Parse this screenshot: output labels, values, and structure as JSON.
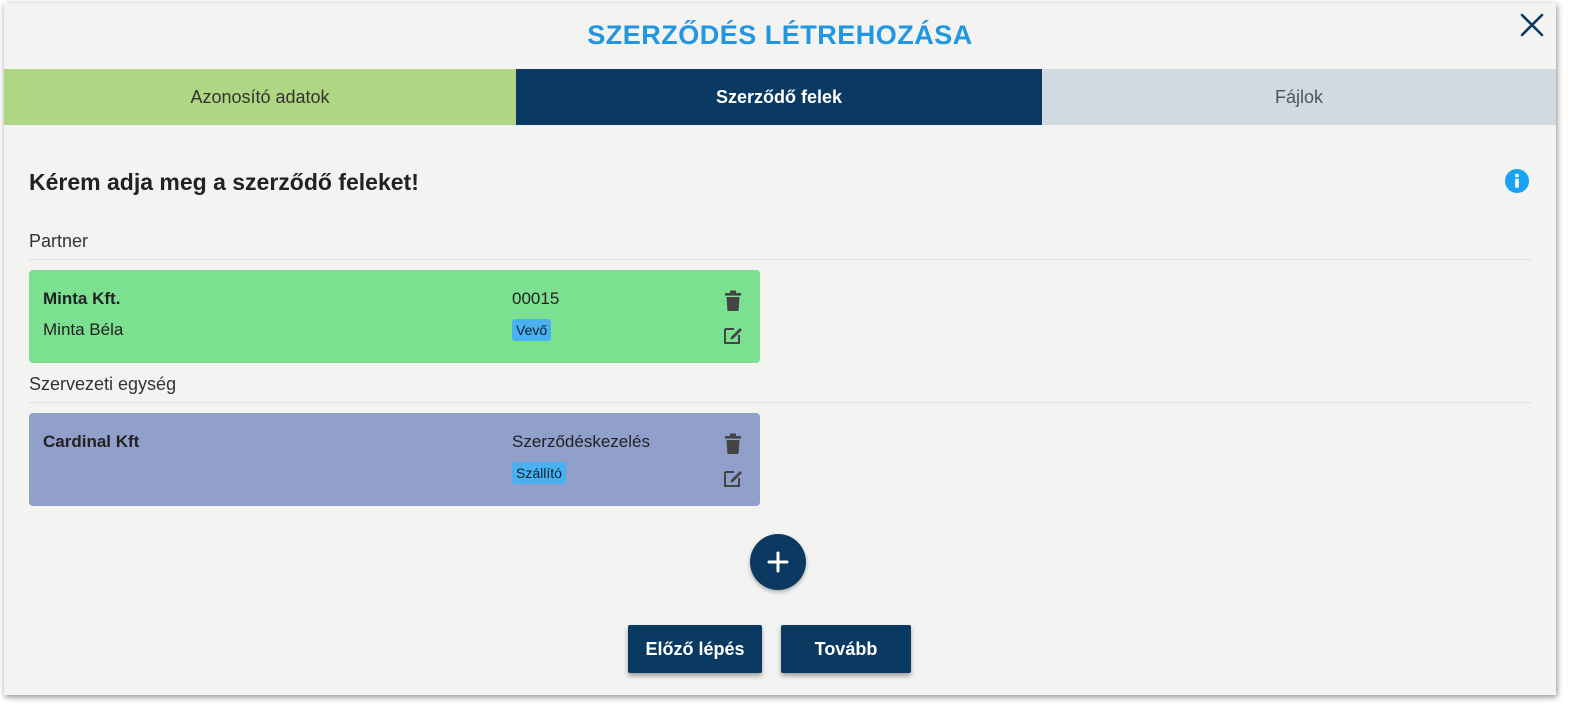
{
  "dialog": {
    "title": "SZERZŐDÉS LÉTREHOZÁSA",
    "close_icon": "close-icon"
  },
  "steps": [
    {
      "label": "Azonosító adatok",
      "state": "completed",
      "color": "#afd683"
    },
    {
      "label": "Szerződő felek",
      "state": "active",
      "color": "#0a3a62"
    },
    {
      "label": "Fájlok",
      "state": "pending",
      "color": "#d2dae1"
    }
  ],
  "main": {
    "heading": "Kérem adja meg a szerződő feleket!",
    "info_icon": "info-icon",
    "sections": [
      {
        "label": "Partner",
        "card": {
          "name": "Minta Kft.",
          "person": "Minta Béla",
          "code": "00015",
          "role": "Vevő",
          "color": "#7be08f"
        }
      },
      {
        "label": "Szervezeti egység",
        "card": {
          "name": "Cardinal Kft",
          "person": "",
          "code": "Szerződéskezelés",
          "role": "Szállító",
          "color": "#919fcb"
        }
      }
    ],
    "add_icon": "plus-icon"
  },
  "footer": {
    "prev_label": "Előző lépés",
    "next_label": "Tovább"
  },
  "colors": {
    "title": "#2196e3",
    "primary": "#0a3a62",
    "badge": "#4ab1f1"
  }
}
